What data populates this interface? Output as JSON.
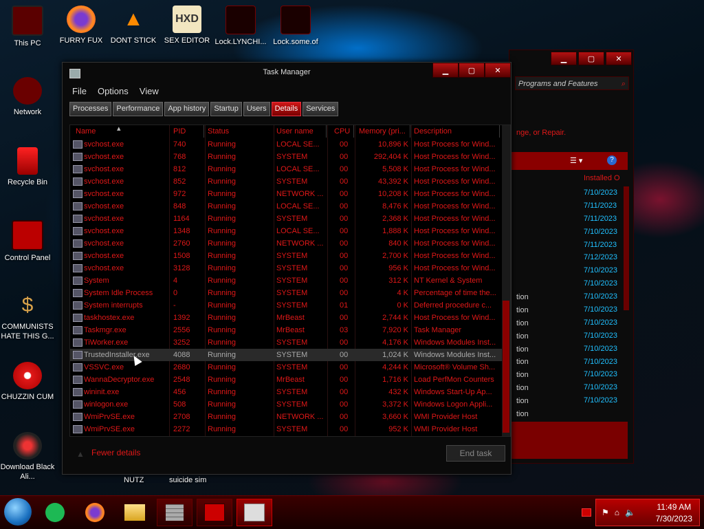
{
  "desktop": {
    "icons": [
      {
        "label": "This PC",
        "icon": "monitor-icon",
        "x": 0,
        "y": 0
      },
      {
        "label": "FURRY FUX",
        "icon": "firefox-icon"
      },
      {
        "label": "DONT STICK",
        "icon": "vlc-cone-icon"
      },
      {
        "label": "SEX EDITOR",
        "icon": "hxd-editor-icon"
      },
      {
        "label": "Lock.LYNCHI...",
        "icon": "lock-file-icon"
      },
      {
        "label": "Lock.some.of",
        "icon": "lock-file-icon"
      },
      {
        "label": "Network",
        "icon": "network-icon"
      },
      {
        "label": "Recycle Bin",
        "icon": "recycle-bin-icon"
      },
      {
        "label": "Control Panel",
        "icon": "control-panel-icon"
      },
      {
        "label": "COMMUNISTS HATE THIS G...",
        "icon": "money-bag-icon"
      },
      {
        "label": "CHUZZIN CUM",
        "icon": "chuzzle-icon"
      },
      {
        "label": "Download Black Ali...",
        "icon": "download-icon"
      },
      {
        "label": "NUTZ",
        "icon": "file-icon"
      },
      {
        "label": "suicide sim",
        "icon": "file-icon"
      }
    ]
  },
  "background_window": {
    "search_placeholder": "Programs and Features",
    "repair_text": "nge, or Repair.",
    "column_header": "Installed O",
    "dates": [
      "7/10/2023",
      "7/11/2023",
      "7/11/2023",
      "7/10/2023",
      "7/11/2023",
      "7/12/2023",
      "7/10/2023",
      "7/10/2023",
      "7/10/2023",
      "7/10/2023",
      "7/10/2023",
      "7/10/2023",
      "7/10/2023",
      "7/10/2023",
      "7/10/2023",
      "7/10/2023",
      "7/10/2023"
    ],
    "tion_items": [
      "tion",
      "tion",
      "tion",
      "tion",
      "tion",
      "tion",
      "tion",
      "tion",
      "tion",
      "tion",
      "tion",
      "tion",
      "tion"
    ]
  },
  "task_manager": {
    "title": "Task Manager",
    "controls": {
      "minimize": "▁",
      "maximize": "▢",
      "close": "✕"
    },
    "menu": [
      "File",
      "Options",
      "View"
    ],
    "tabs": [
      "Processes",
      "Performance",
      "App history",
      "Startup",
      "Users",
      "Details",
      "Services"
    ],
    "active_tab": "Details",
    "columns": [
      "Name",
      "PID",
      "Status",
      "User name",
      "CPU",
      "Memory (pri...",
      "Description"
    ],
    "rows": [
      [
        "svchost.exe",
        "740",
        "Running",
        "LOCAL SE...",
        "00",
        "10,896 K",
        "Host Process for Wind..."
      ],
      [
        "svchost.exe",
        "768",
        "Running",
        "SYSTEM",
        "00",
        "292,404 K",
        "Host Process for Wind..."
      ],
      [
        "svchost.exe",
        "812",
        "Running",
        "LOCAL SE...",
        "00",
        "5,508 K",
        "Host Process for Wind..."
      ],
      [
        "svchost.exe",
        "852",
        "Running",
        "SYSTEM",
        "00",
        "43,392 K",
        "Host Process for Wind..."
      ],
      [
        "svchost.exe",
        "972",
        "Running",
        "NETWORK ...",
        "00",
        "10,208 K",
        "Host Process for Wind..."
      ],
      [
        "svchost.exe",
        "848",
        "Running",
        "LOCAL SE...",
        "00",
        "8,476 K",
        "Host Process for Wind..."
      ],
      [
        "svchost.exe",
        "1164",
        "Running",
        "SYSTEM",
        "00",
        "2,368 K",
        "Host Process for Wind..."
      ],
      [
        "svchost.exe",
        "1348",
        "Running",
        "LOCAL SE...",
        "00",
        "1,888 K",
        "Host Process for Wind..."
      ],
      [
        "svchost.exe",
        "2760",
        "Running",
        "NETWORK ...",
        "00",
        "840 K",
        "Host Process for Wind..."
      ],
      [
        "svchost.exe",
        "1508",
        "Running",
        "SYSTEM",
        "00",
        "2,700 K",
        "Host Process for Wind..."
      ],
      [
        "svchost.exe",
        "3128",
        "Running",
        "SYSTEM",
        "00",
        "956 K",
        "Host Process for Wind..."
      ],
      [
        "System",
        "4",
        "Running",
        "SYSTEM",
        "00",
        "312 K",
        "NT Kernel & System"
      ],
      [
        "System Idle Process",
        "0",
        "Running",
        "SYSTEM",
        "00",
        "4 K",
        "Percentage of time the..."
      ],
      [
        "System interrupts",
        "-",
        "Running",
        "SYSTEM",
        "01",
        "0 K",
        "Deferred procedure c..."
      ],
      [
        "taskhostex.exe",
        "1392",
        "Running",
        "MrBeast",
        "00",
        "2,744 K",
        "Host Process for Wind..."
      ],
      [
        "Taskmgr.exe",
        "2556",
        "Running",
        "MrBeast",
        "03",
        "7,920 K",
        "Task Manager"
      ],
      [
        "TiWorker.exe",
        "3252",
        "Running",
        "SYSTEM",
        "00",
        "4,176 K",
        "Windows Modules Inst..."
      ],
      [
        "TrustedInstaller.exe",
        "4088",
        "Running",
        "SYSTEM",
        "00",
        "1,024 K",
        "Windows Modules Inst..."
      ],
      [
        "VSSVC.exe",
        "2680",
        "Running",
        "SYSTEM",
        "00",
        "4,244 K",
        "Microsoft® Volume Sh..."
      ],
      [
        "WannaDecryptor.exe",
        "2548",
        "Running",
        "MrBeast",
        "00",
        "1,716 K",
        "Load PerfMon Counters"
      ],
      [
        "wininit.exe",
        "456",
        "Running",
        "SYSTEM",
        "00",
        "432 K",
        "Windows Start-Up Ap..."
      ],
      [
        "winlogon.exe",
        "508",
        "Running",
        "SYSTEM",
        "00",
        "3,372 K",
        "Windows Logon Appli..."
      ],
      [
        "WmiPrvSE.exe",
        "2708",
        "Running",
        "NETWORK ...",
        "00",
        "3,660 K",
        "WMI Provider Host"
      ],
      [
        "WmiPrvSE.exe",
        "2272",
        "Running",
        "SYSTEM",
        "00",
        "952 K",
        "WMI Provider Host"
      ]
    ],
    "selected_row": 17,
    "fewer_details": "Fewer details",
    "end_task": "End task"
  },
  "taskbar": {
    "time": "11:49 AM",
    "date": "7/30/2023",
    "items": [
      "start-orb-icon",
      "spotify-icon",
      "firefox-icon",
      "file-explorer-icon",
      "firewall-icon",
      "hacker-app-icon",
      "task-manager-icon"
    ]
  },
  "colors": {
    "accent": "#e01818",
    "accent_dark": "#8a0000",
    "date_blue": "#20c0ff"
  }
}
